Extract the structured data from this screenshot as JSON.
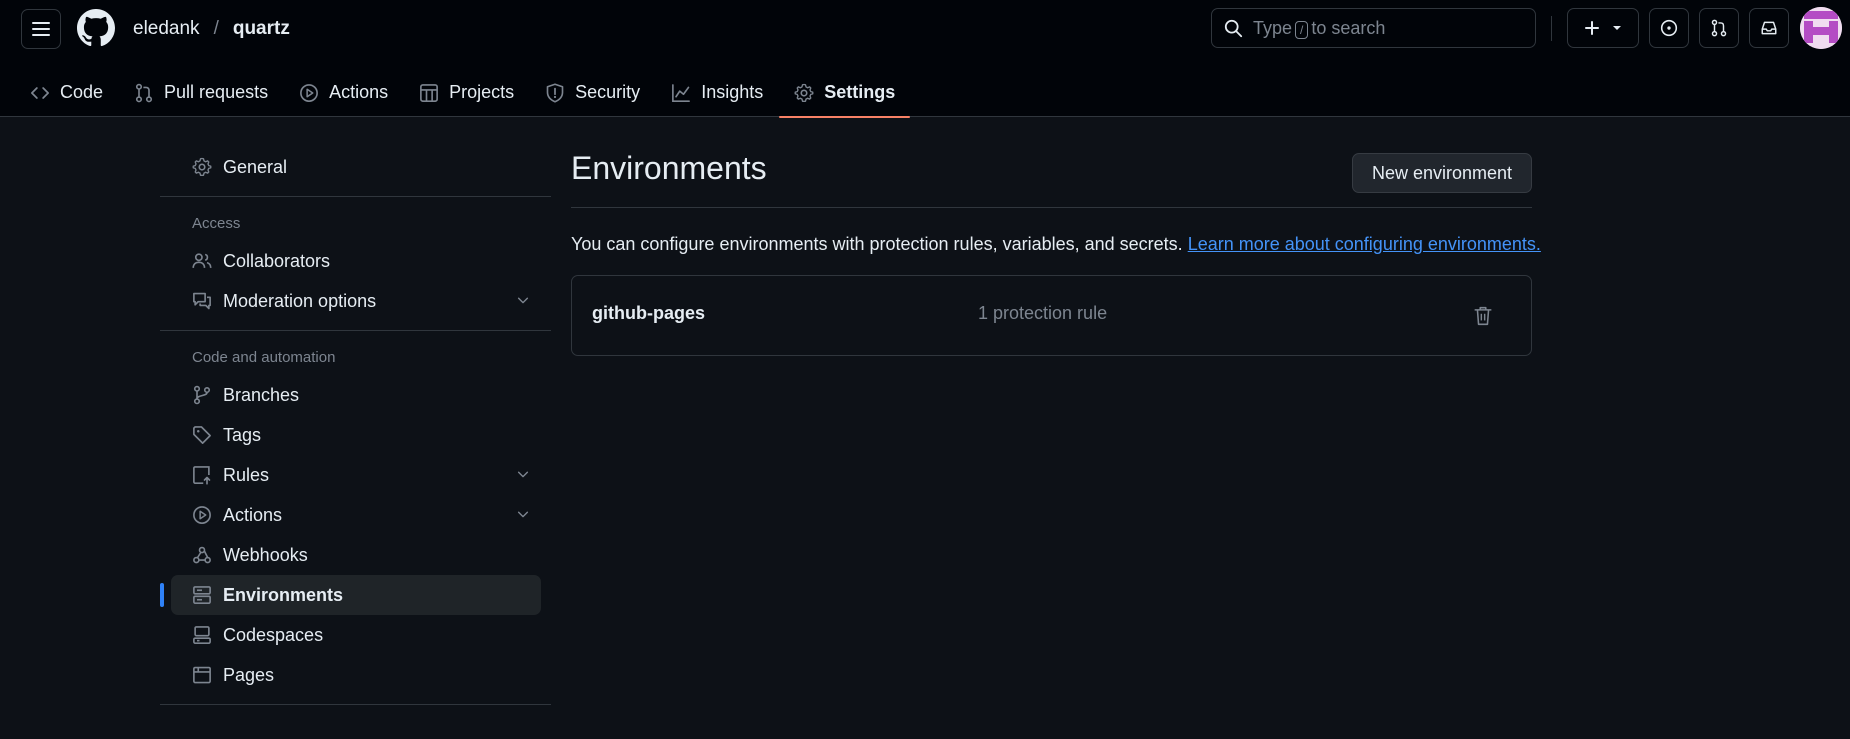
{
  "header": {
    "owner": "eledank",
    "separator": "/",
    "repo": "quartz",
    "search": {
      "prefix": "Type",
      "key": "/",
      "suffix": "to search"
    },
    "icons": [
      "hamburger-icon",
      "github-logo",
      "search-icon",
      "plus-icon",
      "issues-icon",
      "pull-requests-icon",
      "inbox-icon",
      "avatar"
    ]
  },
  "repo_nav": {
    "tabs": [
      {
        "label": "Code",
        "icon": "code-icon"
      },
      {
        "label": "Pull requests",
        "icon": "pull-request-icon"
      },
      {
        "label": "Actions",
        "icon": "actions-icon"
      },
      {
        "label": "Projects",
        "icon": "projects-icon"
      },
      {
        "label": "Security",
        "icon": "shield-icon"
      },
      {
        "label": "Insights",
        "icon": "graph-icon"
      },
      {
        "label": "Settings",
        "icon": "gear-icon",
        "selected": true
      }
    ]
  },
  "sidebar": {
    "general": "General",
    "access_heading": "Access",
    "collaborators": "Collaborators",
    "moderation": "Moderation options",
    "code_heading": "Code and automation",
    "branches": "Branches",
    "tags": "Tags",
    "rules": "Rules",
    "actions": "Actions",
    "webhooks": "Webhooks",
    "environments": "Environments",
    "codespaces": "Codespaces",
    "pages": "Pages"
  },
  "main": {
    "title": "Environments",
    "new_button": "New environment",
    "description": "You can configure environments with protection rules, variables, and secrets.",
    "learn_more": "Learn more about configuring environments.",
    "environments": [
      {
        "name": "github-pages",
        "rules": "1 protection rule"
      }
    ]
  },
  "colors": {
    "background": "#0d1117",
    "header": "#010409",
    "accent_tab": "#f78166",
    "link": "#4493f8",
    "active_bar": "#2f81f7"
  }
}
